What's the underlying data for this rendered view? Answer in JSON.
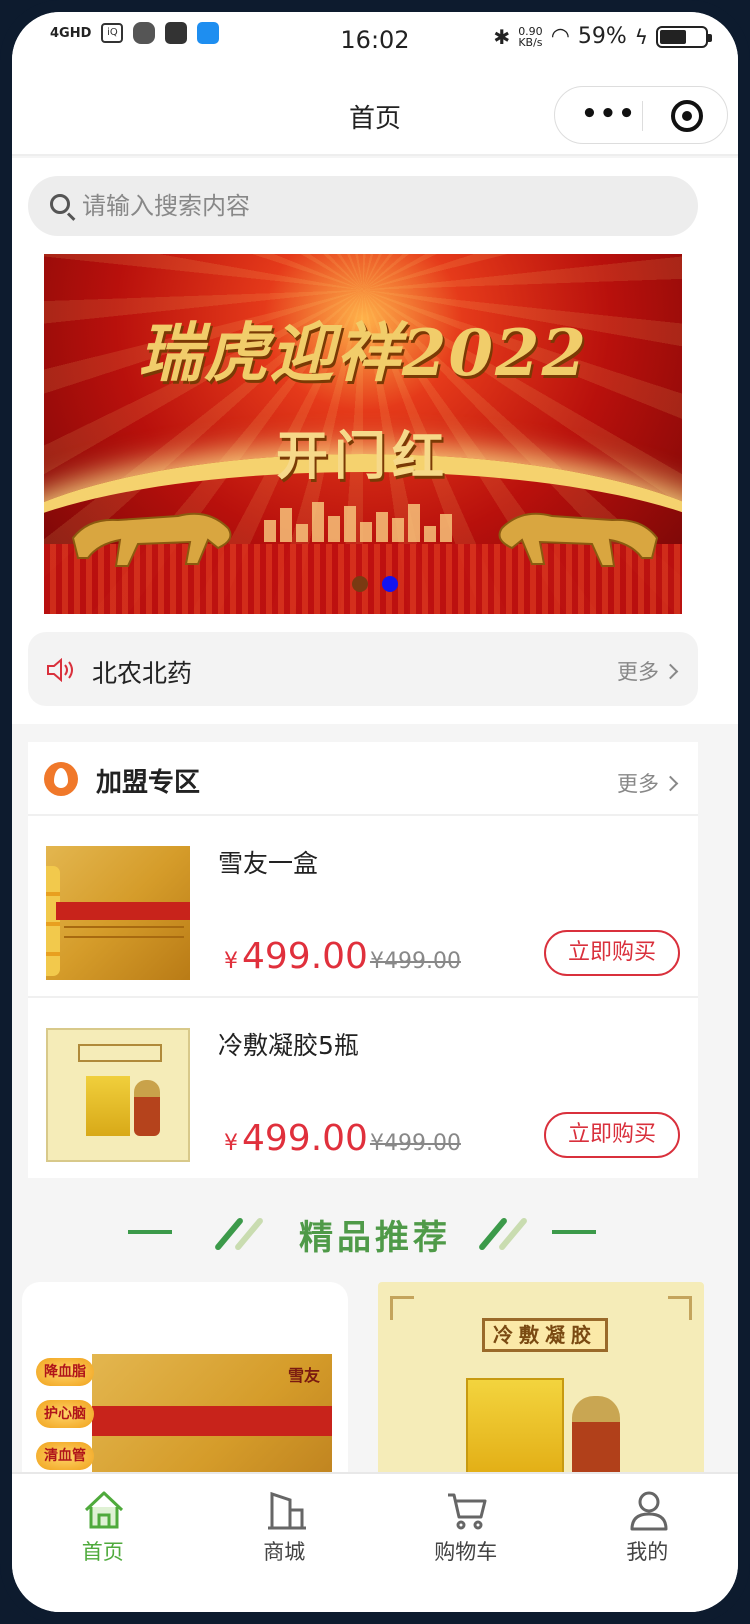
{
  "status_bar": {
    "network": "4GHD",
    "time": "16:02",
    "speed_value": "0.90",
    "speed_unit": "KB/s",
    "battery": "59%"
  },
  "nav": {
    "title": "首页",
    "more_label": "•••"
  },
  "search": {
    "placeholder": "请输入搜索内容"
  },
  "banner": {
    "headline": "瑞虎迎祥2022",
    "subline": "开门红",
    "slide_count": 2,
    "active_slide": 2,
    "inactive_dot_color": "#7a3a12",
    "active_dot_color": "#1414f0"
  },
  "notice": {
    "text": "北农北药",
    "more": "更多"
  },
  "franchise": {
    "title": "加盟专区",
    "more": "更多",
    "products": [
      {
        "name": "雪友一盒",
        "currency": "¥",
        "price": "499.00",
        "original_price": "¥499.00",
        "buy_label": "立即购买"
      },
      {
        "name": "冷敷凝胶5瓶",
        "currency": "¥",
        "price": "499.00",
        "original_price": "¥499.00",
        "buy_label": "立即购买"
      }
    ]
  },
  "recommended": {
    "title": "精品推荐"
  },
  "cards": [
    {
      "brand": "雪友",
      "badges": [
        "降血脂",
        "护心脑",
        "清血管"
      ]
    },
    {
      "title": "冷敷凝胶"
    }
  ],
  "tabbar": {
    "items": [
      {
        "label": "首页",
        "icon": "home-icon",
        "active": true
      },
      {
        "label": "商城",
        "icon": "building-icon",
        "active": false
      },
      {
        "label": "购物车",
        "icon": "cart-icon",
        "active": false
      },
      {
        "label": "我的",
        "icon": "user-icon",
        "active": false
      }
    ],
    "active_color": "#4faa3c"
  },
  "colors": {
    "price_red": "#e0303c",
    "accent_green": "#4f9a48"
  }
}
